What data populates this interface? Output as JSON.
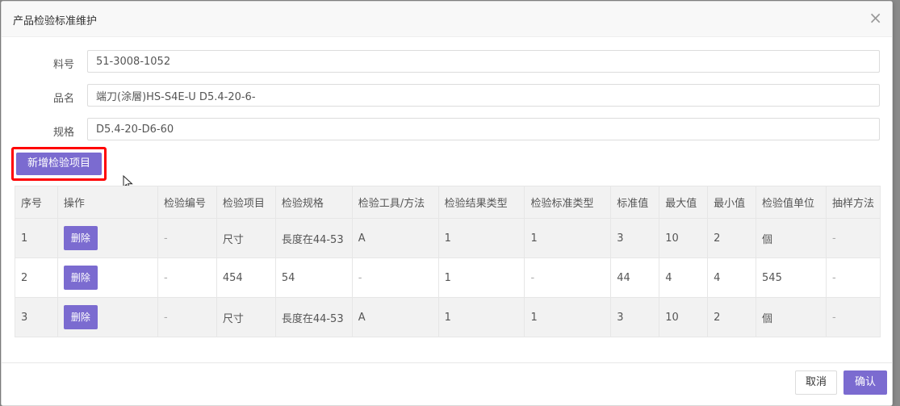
{
  "dialog": {
    "title": "产品检验标准维护",
    "close_glyph": "×"
  },
  "form": {
    "part_no_label": "料号",
    "part_no_value": "51-3008-1052",
    "name_label": "品名",
    "name_value": "端刀(涂層)HS-S4E-U D5.4-20-6-",
    "spec_label": "规格",
    "spec_value": "D5.4-20-D6-60"
  },
  "toolbar": {
    "add_label": "新增检验项目"
  },
  "table": {
    "headers": [
      "序号",
      "操作",
      "检验编号",
      "检验项目",
      "检验规格",
      "检验工具/方法",
      "检验结果类型",
      "检验标准类型",
      "标准值",
      "最大值",
      "最小值",
      "检验值单位",
      "抽样方法"
    ],
    "delete_label": "删除",
    "rows": [
      {
        "seq": "1",
        "code": "-",
        "item": "尺寸",
        "spec": "長度在44-53",
        "tool": "A",
        "result_type": "1",
        "std_type": "1",
        "std": "3",
        "max": "10",
        "min": "2",
        "unit": "個",
        "sampling": "-"
      },
      {
        "seq": "2",
        "code": "-",
        "item": "454",
        "spec": "54",
        "tool": "-",
        "result_type": "1",
        "std_type": "-",
        "std": "44",
        "max": "4",
        "min": "4",
        "unit": "545",
        "sampling": "-"
      },
      {
        "seq": "3",
        "code": "-",
        "item": "尺寸",
        "spec": "長度在44-53",
        "tool": "A",
        "result_type": "1",
        "std_type": "1",
        "std": "3",
        "max": "10",
        "min": "2",
        "unit": "個",
        "sampling": "-"
      }
    ]
  },
  "footer": {
    "cancel_label": "取消",
    "ok_label": "确认"
  },
  "colors": {
    "accent": "#7b6bd0",
    "highlight": "#ff0000"
  }
}
